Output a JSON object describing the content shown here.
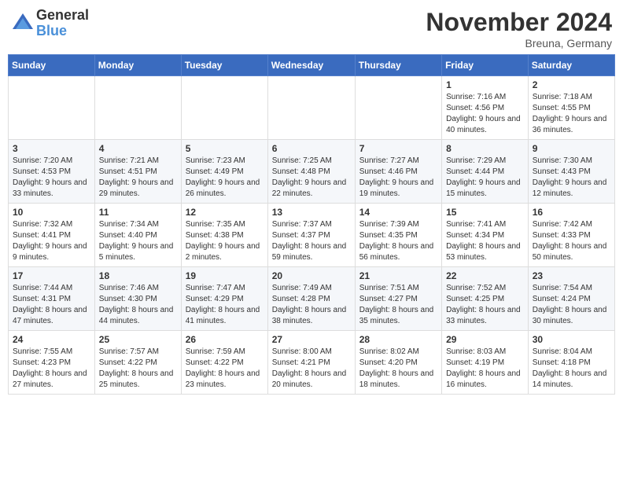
{
  "logo": {
    "general": "General",
    "blue": "Blue"
  },
  "header": {
    "month": "November 2024",
    "location": "Breuna, Germany"
  },
  "weekdays": [
    "Sunday",
    "Monday",
    "Tuesday",
    "Wednesday",
    "Thursday",
    "Friday",
    "Saturday"
  ],
  "weeks": [
    [
      {
        "day": "",
        "info": ""
      },
      {
        "day": "",
        "info": ""
      },
      {
        "day": "",
        "info": ""
      },
      {
        "day": "",
        "info": ""
      },
      {
        "day": "",
        "info": ""
      },
      {
        "day": "1",
        "info": "Sunrise: 7:16 AM\nSunset: 4:56 PM\nDaylight: 9 hours and 40 minutes."
      },
      {
        "day": "2",
        "info": "Sunrise: 7:18 AM\nSunset: 4:55 PM\nDaylight: 9 hours and 36 minutes."
      }
    ],
    [
      {
        "day": "3",
        "info": "Sunrise: 7:20 AM\nSunset: 4:53 PM\nDaylight: 9 hours and 33 minutes."
      },
      {
        "day": "4",
        "info": "Sunrise: 7:21 AM\nSunset: 4:51 PM\nDaylight: 9 hours and 29 minutes."
      },
      {
        "day": "5",
        "info": "Sunrise: 7:23 AM\nSunset: 4:49 PM\nDaylight: 9 hours and 26 minutes."
      },
      {
        "day": "6",
        "info": "Sunrise: 7:25 AM\nSunset: 4:48 PM\nDaylight: 9 hours and 22 minutes."
      },
      {
        "day": "7",
        "info": "Sunrise: 7:27 AM\nSunset: 4:46 PM\nDaylight: 9 hours and 19 minutes."
      },
      {
        "day": "8",
        "info": "Sunrise: 7:29 AM\nSunset: 4:44 PM\nDaylight: 9 hours and 15 minutes."
      },
      {
        "day": "9",
        "info": "Sunrise: 7:30 AM\nSunset: 4:43 PM\nDaylight: 9 hours and 12 minutes."
      }
    ],
    [
      {
        "day": "10",
        "info": "Sunrise: 7:32 AM\nSunset: 4:41 PM\nDaylight: 9 hours and 9 minutes."
      },
      {
        "day": "11",
        "info": "Sunrise: 7:34 AM\nSunset: 4:40 PM\nDaylight: 9 hours and 5 minutes."
      },
      {
        "day": "12",
        "info": "Sunrise: 7:35 AM\nSunset: 4:38 PM\nDaylight: 9 hours and 2 minutes."
      },
      {
        "day": "13",
        "info": "Sunrise: 7:37 AM\nSunset: 4:37 PM\nDaylight: 8 hours and 59 minutes."
      },
      {
        "day": "14",
        "info": "Sunrise: 7:39 AM\nSunset: 4:35 PM\nDaylight: 8 hours and 56 minutes."
      },
      {
        "day": "15",
        "info": "Sunrise: 7:41 AM\nSunset: 4:34 PM\nDaylight: 8 hours and 53 minutes."
      },
      {
        "day": "16",
        "info": "Sunrise: 7:42 AM\nSunset: 4:33 PM\nDaylight: 8 hours and 50 minutes."
      }
    ],
    [
      {
        "day": "17",
        "info": "Sunrise: 7:44 AM\nSunset: 4:31 PM\nDaylight: 8 hours and 47 minutes."
      },
      {
        "day": "18",
        "info": "Sunrise: 7:46 AM\nSunset: 4:30 PM\nDaylight: 8 hours and 44 minutes."
      },
      {
        "day": "19",
        "info": "Sunrise: 7:47 AM\nSunset: 4:29 PM\nDaylight: 8 hours and 41 minutes."
      },
      {
        "day": "20",
        "info": "Sunrise: 7:49 AM\nSunset: 4:28 PM\nDaylight: 8 hours and 38 minutes."
      },
      {
        "day": "21",
        "info": "Sunrise: 7:51 AM\nSunset: 4:27 PM\nDaylight: 8 hours and 35 minutes."
      },
      {
        "day": "22",
        "info": "Sunrise: 7:52 AM\nSunset: 4:25 PM\nDaylight: 8 hours and 33 minutes."
      },
      {
        "day": "23",
        "info": "Sunrise: 7:54 AM\nSunset: 4:24 PM\nDaylight: 8 hours and 30 minutes."
      }
    ],
    [
      {
        "day": "24",
        "info": "Sunrise: 7:55 AM\nSunset: 4:23 PM\nDaylight: 8 hours and 27 minutes."
      },
      {
        "day": "25",
        "info": "Sunrise: 7:57 AM\nSunset: 4:22 PM\nDaylight: 8 hours and 25 minutes."
      },
      {
        "day": "26",
        "info": "Sunrise: 7:59 AM\nSunset: 4:22 PM\nDaylight: 8 hours and 23 minutes."
      },
      {
        "day": "27",
        "info": "Sunrise: 8:00 AM\nSunset: 4:21 PM\nDaylight: 8 hours and 20 minutes."
      },
      {
        "day": "28",
        "info": "Sunrise: 8:02 AM\nSunset: 4:20 PM\nDaylight: 8 hours and 18 minutes."
      },
      {
        "day": "29",
        "info": "Sunrise: 8:03 AM\nSunset: 4:19 PM\nDaylight: 8 hours and 16 minutes."
      },
      {
        "day": "30",
        "info": "Sunrise: 8:04 AM\nSunset: 4:18 PM\nDaylight: 8 hours and 14 minutes."
      }
    ]
  ]
}
